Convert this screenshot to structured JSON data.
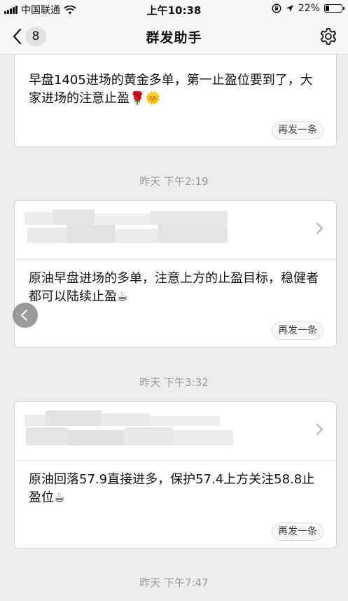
{
  "status": {
    "carrier": "中国联通",
    "time": "上午10:38",
    "battery": "22%",
    "battery_level": 0.22
  },
  "nav": {
    "badge": "8",
    "title": "群发助手"
  },
  "messages": [
    {
      "text": "早盘1405进场的黄金多单，第一止盈位要到了，大家进场的注意止盈🌹🌞",
      "resend": "再发一条"
    },
    {
      "text": "原油早盘进场的多单，注意上方的止盈目标，稳健者都可以陆续止盈☕",
      "resend": "再发一条"
    },
    {
      "text": "原油回落57.9直接进多，保护57.4上方关注58.8止盈位☕",
      "resend": "再发一条"
    }
  ],
  "timestamps": [
    "昨天 下午2:19",
    "昨天 下午3:32",
    "昨天 下午7:47"
  ],
  "colors": {
    "background": "#ededed",
    "card": "#ffffff",
    "timestamp": "#9a9a9a"
  },
  "icons": [
    "back-chevron-icon",
    "gear-icon",
    "chevron-right-icon",
    "wifi-icon",
    "location-icon",
    "lock-rotation-icon",
    "battery-icon"
  ]
}
